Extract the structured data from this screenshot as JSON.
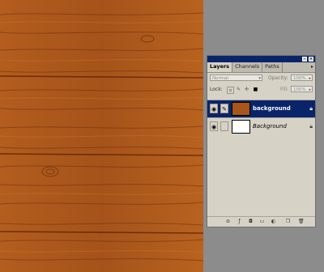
{
  "panel": {
    "tabs": [
      "Layers",
      "Channels",
      "Paths"
    ],
    "blend_mode": "Normal",
    "opacity_label": "Opacity:",
    "opacity_value": "100%",
    "lock_label": "Lock:",
    "fill_label": "Fill:",
    "fill_value": "100%",
    "layers": [
      {
        "name": "background",
        "selected": true
      },
      {
        "name": "Background",
        "selected": false
      }
    ]
  },
  "colors": {
    "wood": "#a8561a",
    "selection": "#0a246a",
    "panel_bg": "#d6d2c6"
  }
}
